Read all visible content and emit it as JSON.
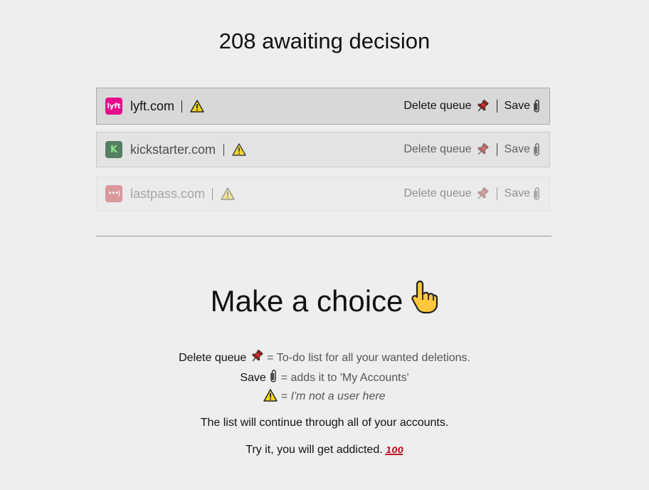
{
  "header": {
    "title": "208 awaiting decision"
  },
  "accounts": [
    {
      "domain": "lyft.com",
      "logo_text": "lyft",
      "logo_color": "#e60c8b",
      "delete_label": "Delete queue",
      "save_label": "Save"
    },
    {
      "domain": "kickstarter.com",
      "logo_text": "K",
      "logo_color": "#3c6b4a",
      "delete_label": "Delete queue",
      "save_label": "Save"
    },
    {
      "domain": "lastpass.com",
      "logo_text": "•••|",
      "logo_color": "#c0242c",
      "delete_label": "Delete queue",
      "save_label": "Save"
    }
  ],
  "icons": {
    "delete": "pushpin-icon",
    "save": "paperclip-icon",
    "not_user": "warning-icon",
    "pointer": "pointing-up-hand-icon"
  },
  "instructions": {
    "title": "Make a choice",
    "delete_term": "Delete queue",
    "delete_desc": "= To-do list for all your wanted deletions.",
    "save_term": "Save",
    "save_desc": "= adds it to 'My Accounts'",
    "warn_eq": "=",
    "warn_desc": "I'm not a user here",
    "continue_text": "The list will continue through all of your accounts.",
    "addicted_text": "Try it, you will get addicted.",
    "hundred": "100"
  },
  "colors": {
    "background": "#eeeeee",
    "pin": "#d8302a",
    "warning": "#f2d41a"
  }
}
